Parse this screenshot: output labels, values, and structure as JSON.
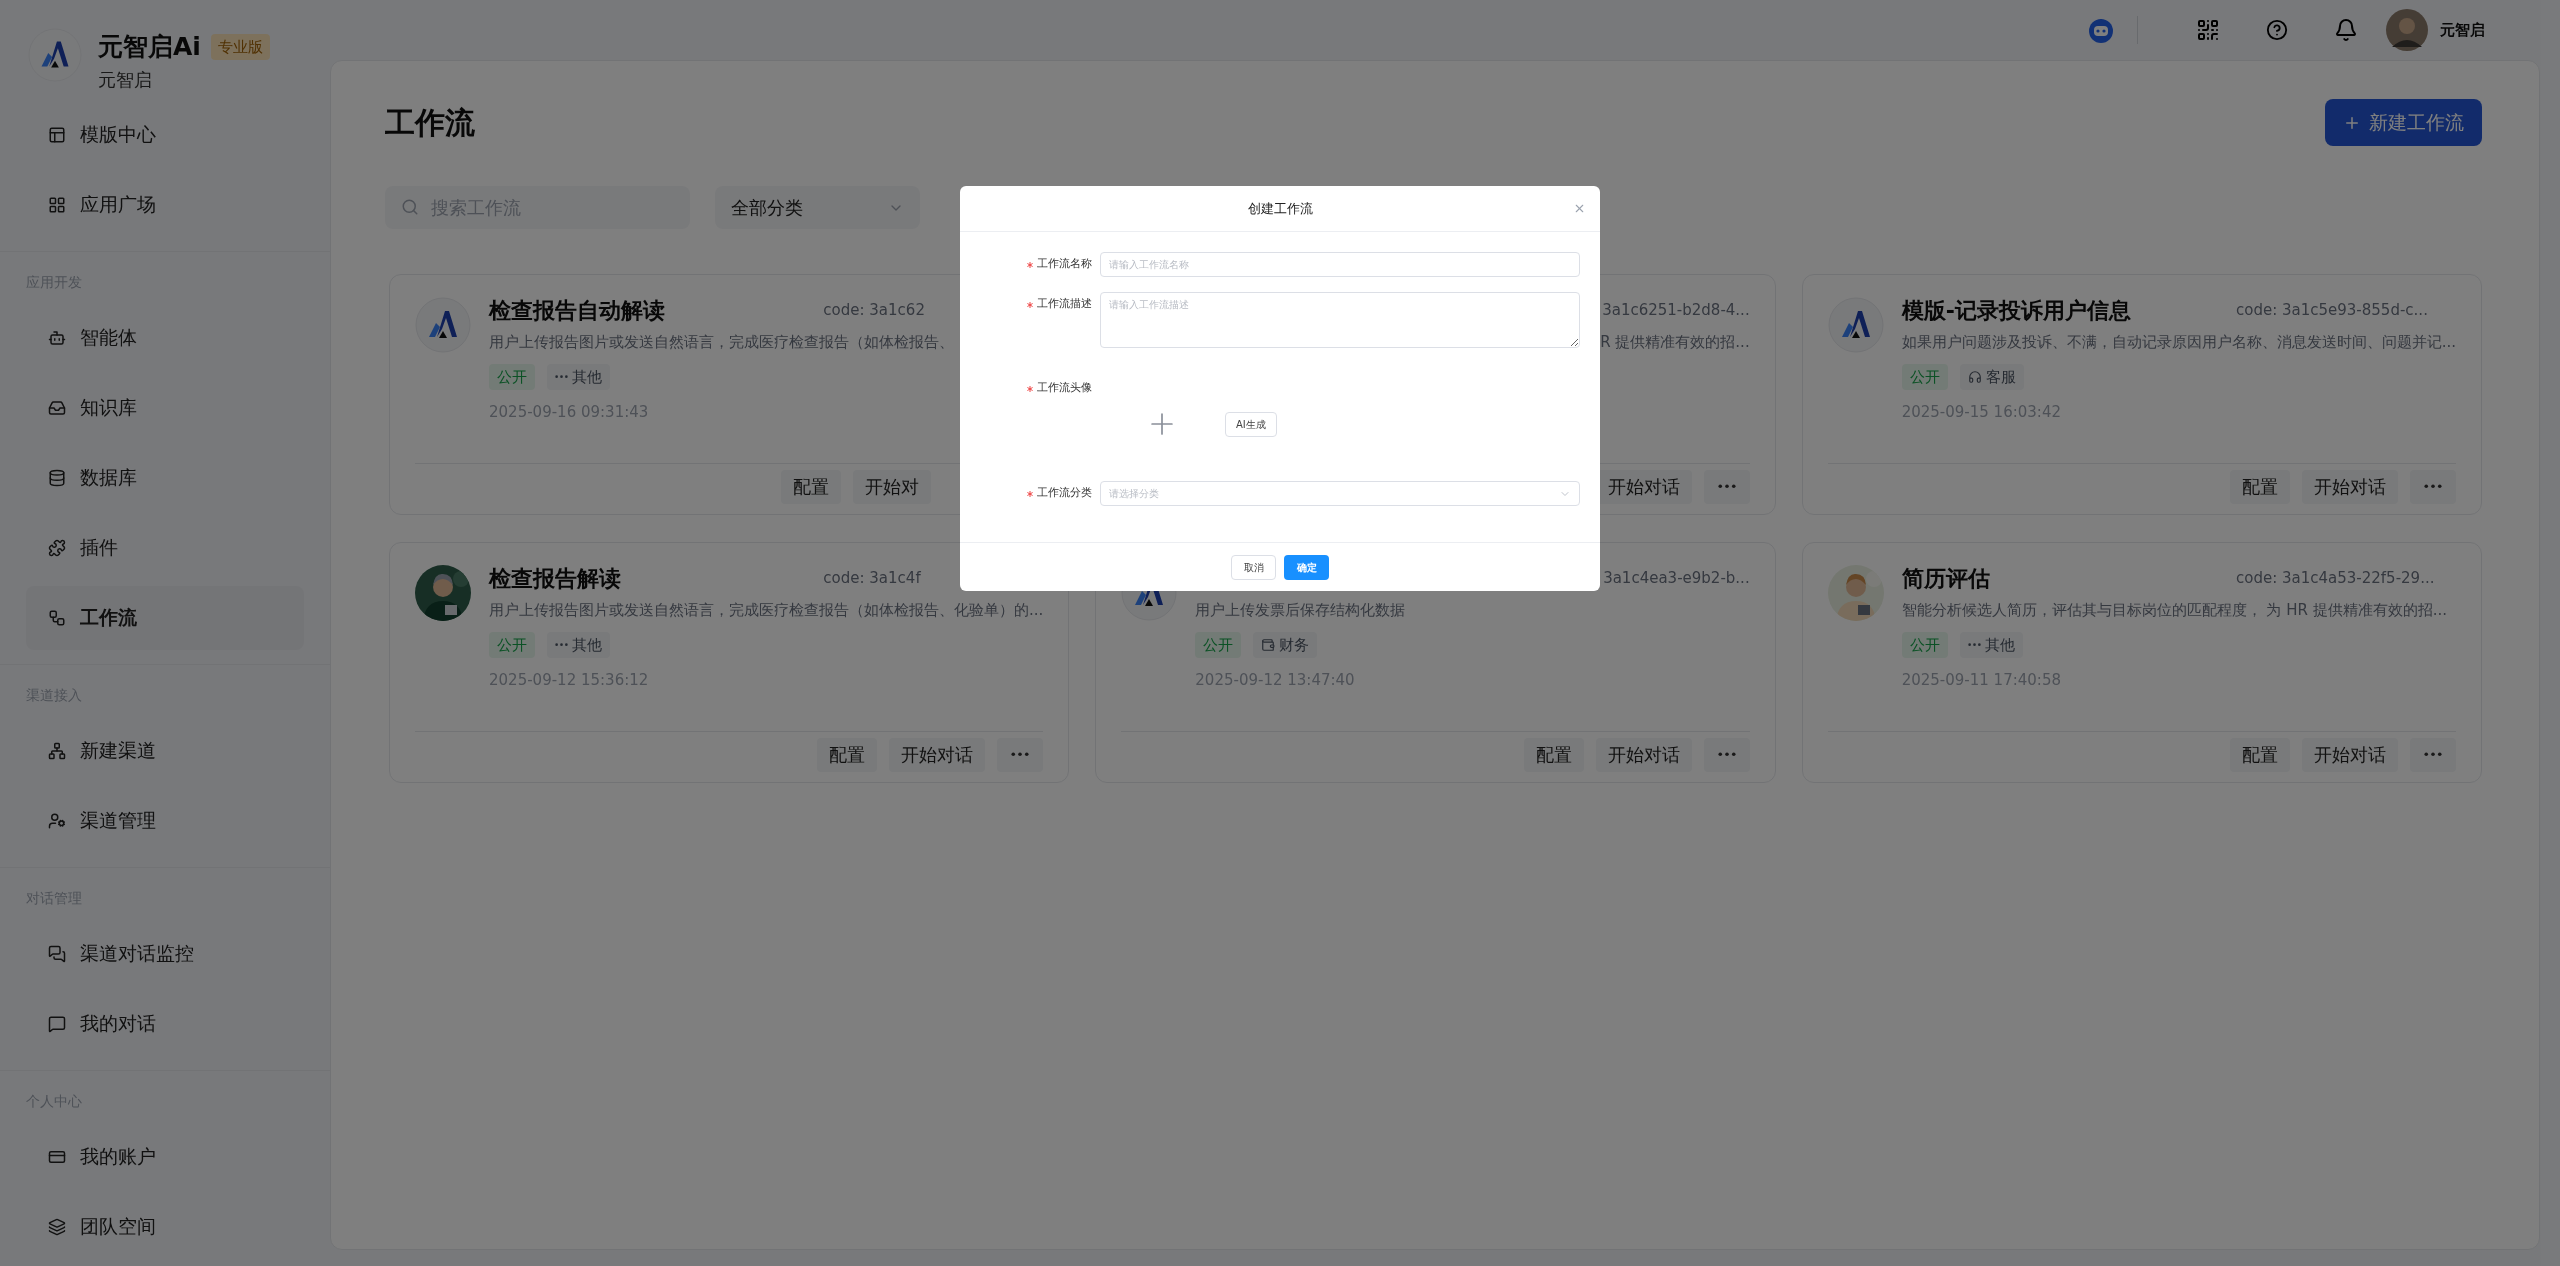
{
  "brand": {
    "name": "元智启Ai",
    "badge": "专业版",
    "subtitle": "元智启"
  },
  "sidebar": {
    "groups": [
      {
        "items": [
          {
            "label": "模版中心",
            "selected": false
          },
          {
            "label": "应用广场",
            "selected": false
          }
        ]
      },
      {
        "heading": "应用开发",
        "items": [
          {
            "label": "智能体",
            "selected": false
          },
          {
            "label": "知识库",
            "selected": false
          },
          {
            "label": "数据库",
            "selected": false
          },
          {
            "label": "插件",
            "selected": false
          },
          {
            "label": "工作流",
            "selected": true
          }
        ]
      },
      {
        "heading": "渠道接入",
        "items": [
          {
            "label": "新建渠道",
            "selected": false
          },
          {
            "label": "渠道管理",
            "selected": false
          }
        ]
      },
      {
        "heading": "对话管理",
        "items": [
          {
            "label": "渠道对话监控",
            "selected": false
          },
          {
            "label": "我的对话",
            "selected": false
          }
        ]
      },
      {
        "heading": "个人中心",
        "items": [
          {
            "label": "我的账户",
            "selected": false
          },
          {
            "label": "团队空间",
            "selected": false
          }
        ]
      }
    ]
  },
  "header": {
    "user": "元智启"
  },
  "page": {
    "title": "工作流",
    "new_button": "新建工作流",
    "search": {
      "placeholder": "搜索工作流"
    },
    "category": {
      "value": "全部分类"
    }
  },
  "cards": [
    {
      "avatar": {
        "kind": "logo"
      },
      "title": "检查报告自动解读",
      "code": "code: 3a1c62",
      "desc": "用户上传报告图片或发送自然语言，完成医疗检查报告（如体检报告、",
      "tags": [
        {
          "kind": "public",
          "label": "公开"
        },
        {
          "kind": "other",
          "label": "其他"
        }
      ],
      "date": "2025-09-16 09:31:43",
      "buttons": [
        "配置",
        "开始对"
      ],
      "more": false
    },
    {
      "code": "3a1c6251-b2d8-4...",
      "clipped_left": true,
      "desc": "R 提供精准有效的招...",
      "buttons": [
        "开始对话"
      ],
      "more": true
    },
    {
      "avatar": {
        "kind": "logo"
      },
      "title": "模版-记录投诉用户信息",
      "code": "code: 3a1c5e93-855d-c...",
      "desc": "如果用户问题涉及投诉、不满，自动记录原因用户名称、消息发送时间、问题并记...",
      "tags": [
        {
          "kind": "public",
          "label": "公开"
        },
        {
          "kind": "service",
          "label": "客服"
        }
      ],
      "date": "2025-09-15 16:03:42",
      "buttons": [
        "配置",
        "开始对话"
      ],
      "more": true
    },
    {
      "title": "检查报告解读",
      "code": "code: 3a1c4f",
      "desc": "用户上传报告图片或发送自然语言，完成医疗检查报告（如体检报告、化验单）的...",
      "tags": [
        {
          "kind": "public",
          "label": "公开"
        },
        {
          "kind": "other",
          "label": "其他"
        }
      ],
      "date": "2025-09-12 15:36:12",
      "buttons": [
        "配置",
        "开始对话"
      ],
      "more": true
    },
    {
      "avatar": {
        "kind": "logo"
      },
      "code": "3a1c4ea3-e9b2-b...",
      "clipped_left": true,
      "desc": "用户上传发票后保存结构化数据",
      "tags": [
        {
          "kind": "public",
          "label": "公开"
        },
        {
          "kind": "finance",
          "label": "财务"
        }
      ],
      "date": "2025-09-12 13:47:40",
      "buttons": [
        "配置",
        "开始对话"
      ],
      "more": true
    },
    {
      "title": "简历评估",
      "code": "code: 3a1c4a53-22f5-29...",
      "desc": "智能分析候选人简历，评估其与目标岗位的匹配程度， 为 HR 提供精准有效的招...",
      "tags": [
        {
          "kind": "public",
          "label": "公开"
        },
        {
          "kind": "other",
          "label": "其他"
        }
      ],
      "date": "2025-09-11 17:40:58",
      "buttons": [
        "配置",
        "开始对话"
      ],
      "more": true
    }
  ],
  "dialog": {
    "title": "创建工作流",
    "fields": [
      {
        "kind": "input",
        "label": "工作流名称",
        "required": true,
        "placeholder": "请输入工作流名称"
      },
      {
        "kind": "textarea",
        "label": "工作流描述",
        "required": true,
        "placeholder": "请输入工作流描述"
      },
      {
        "kind": "avatar",
        "label": "工作流头像",
        "required": true,
        "button": "AI生成"
      },
      {
        "kind": "select",
        "label": "工作流分类",
        "required": true,
        "placeholder": "请选择分类"
      }
    ],
    "buttons": [
      {
        "label": "取消",
        "primary": false
      },
      {
        "label": "确定",
        "primary": true
      }
    ]
  }
}
